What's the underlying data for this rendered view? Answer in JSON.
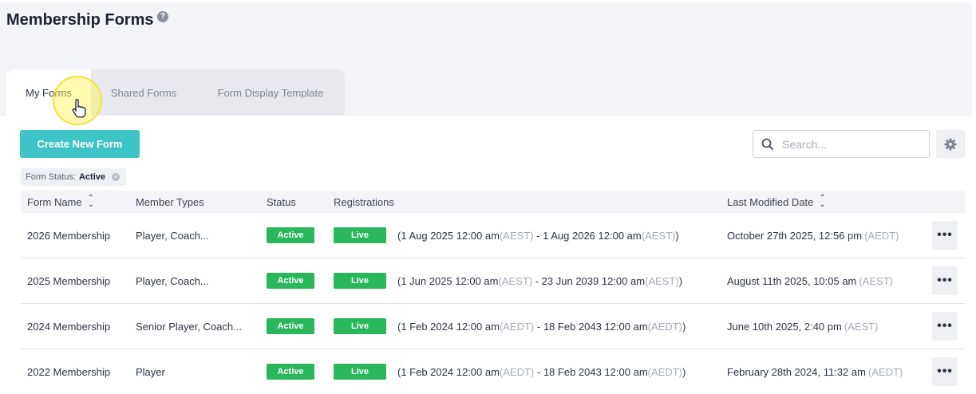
{
  "header": {
    "title": "Membership Forms"
  },
  "tabs": [
    {
      "label": "My Forms",
      "active": true
    },
    {
      "label": "Shared Forms",
      "active": false
    },
    {
      "label": "Form Display Template",
      "active": false
    }
  ],
  "toolbar": {
    "create_label": "Create New Form",
    "search_placeholder": "Search..."
  },
  "filter": {
    "label": "Form Status:",
    "value": "Active"
  },
  "table": {
    "columns": {
      "form_name": "Form Name",
      "member_types": "Member Types",
      "status": "Status",
      "registrations": "Registrations",
      "last_modified": "Last Modified Date"
    },
    "rows": [
      {
        "name": "2026 Membership",
        "member_types": "Player, Coach...",
        "status": "Active",
        "reg_badge": "Live",
        "reg_open": "(1 Aug 2025 12:00 am",
        "reg_open_tz": "(AEST)",
        "reg_sep": " - ",
        "reg_close": "1 Aug 2026 12:00 am",
        "reg_close_tz": "(AEST)",
        "reg_end": ")",
        "modified": "October 27th 2025, 12:56 pm",
        "modified_tz": "(AEDT)"
      },
      {
        "name": "2025 Membership",
        "member_types": "Player, Coach...",
        "status": "Active",
        "reg_badge": "Live",
        "reg_open": "(1 Jun 2025 12:00 am",
        "reg_open_tz": "(AEST)",
        "reg_sep": " - ",
        "reg_close": "23 Jun 2039 12:00 am",
        "reg_close_tz": "(AEST)",
        "reg_end": ")",
        "modified": "August 11th 2025, 10:05 am",
        "modified_tz": "(AEST)"
      },
      {
        "name": "2024 Membership",
        "member_types": "Senior Player, Coach...",
        "status": "Active",
        "reg_badge": "Live",
        "reg_open": "(1 Feb 2024 12:00 am",
        "reg_open_tz": "(AEDT)",
        "reg_sep": " - ",
        "reg_close": "18 Feb 2043 12:00 am",
        "reg_close_tz": "(AEDT)",
        "reg_end": ")",
        "modified": "June 10th 2025, 2:40 pm",
        "modified_tz": "(AEST)"
      },
      {
        "name": "2022 Membership",
        "member_types": "Player",
        "status": "Active",
        "reg_badge": "Live",
        "reg_open": "(1 Feb 2024 12:00 am",
        "reg_open_tz": "(AEDT)",
        "reg_sep": " - ",
        "reg_close": "18 Feb 2043 12:00 am",
        "reg_close_tz": "(AEDT)",
        "reg_end": ")",
        "modified": "February 28th 2024, 11:32 am",
        "modified_tz": "(AEDT)"
      }
    ]
  },
  "colors": {
    "accent": "#3ec3c7",
    "status_green": "#2ab65a",
    "header_bg": "#f3f4f8"
  },
  "icons": [
    "help-icon",
    "search-icon",
    "gear-icon",
    "sort-icon",
    "more-icon",
    "close-icon",
    "pointer-cursor-icon"
  ]
}
